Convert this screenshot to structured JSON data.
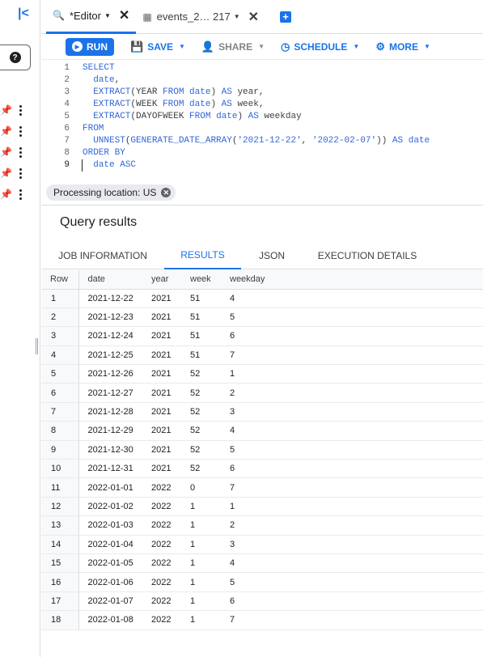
{
  "sidebar": {
    "collapse_icon": "collapse-left-icon",
    "help_icon": "help-icon",
    "pinned_items": 5
  },
  "tabs": [
    {
      "label": "*Editor",
      "icon": "query-icon",
      "active": true
    },
    {
      "label": "events_2… 217",
      "icon": "table-icon",
      "active": false
    }
  ],
  "toolbar": {
    "run": "RUN",
    "save": "SAVE",
    "share": "SHARE",
    "schedule": "SCHEDULE",
    "more": "MORE"
  },
  "editor": {
    "line_numbers": [
      "1",
      "2",
      "3",
      "4",
      "5",
      "6",
      "7",
      "8",
      "9"
    ]
  },
  "processing_location": "Processing location: US",
  "results": {
    "title": "Query results",
    "tabs": [
      "JOB INFORMATION",
      "RESULTS",
      "JSON",
      "EXECUTION DETAILS"
    ],
    "active_tab": "RESULTS",
    "columns": [
      "Row",
      "date",
      "year",
      "week",
      "weekday"
    ],
    "rows": [
      [
        "1",
        "2021-12-22",
        "2021",
        "51",
        "4"
      ],
      [
        "2",
        "2021-12-23",
        "2021",
        "51",
        "5"
      ],
      [
        "3",
        "2021-12-24",
        "2021",
        "51",
        "6"
      ],
      [
        "4",
        "2021-12-25",
        "2021",
        "51",
        "7"
      ],
      [
        "5",
        "2021-12-26",
        "2021",
        "52",
        "1"
      ],
      [
        "6",
        "2021-12-27",
        "2021",
        "52",
        "2"
      ],
      [
        "7",
        "2021-12-28",
        "2021",
        "52",
        "3"
      ],
      [
        "8",
        "2021-12-29",
        "2021",
        "52",
        "4"
      ],
      [
        "9",
        "2021-12-30",
        "2021",
        "52",
        "5"
      ],
      [
        "10",
        "2021-12-31",
        "2021",
        "52",
        "6"
      ],
      [
        "11",
        "2022-01-01",
        "2022",
        "0",
        "7"
      ],
      [
        "12",
        "2022-01-02",
        "2022",
        "1",
        "1"
      ],
      [
        "13",
        "2022-01-03",
        "2022",
        "1",
        "2"
      ],
      [
        "14",
        "2022-01-04",
        "2022",
        "1",
        "3"
      ],
      [
        "15",
        "2022-01-05",
        "2022",
        "1",
        "4"
      ],
      [
        "16",
        "2022-01-06",
        "2022",
        "1",
        "5"
      ],
      [
        "17",
        "2022-01-07",
        "2022",
        "1",
        "6"
      ],
      [
        "18",
        "2022-01-08",
        "2022",
        "1",
        "7"
      ]
    ]
  },
  "colors": {
    "accent": "#1a73e8",
    "keyword": "#3367d6"
  }
}
